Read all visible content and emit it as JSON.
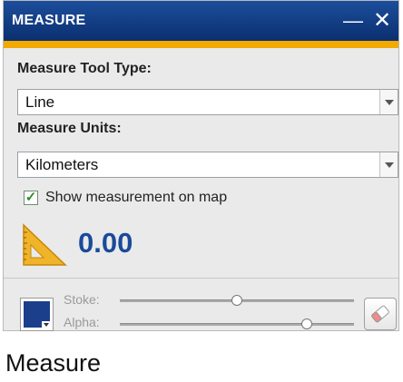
{
  "window": {
    "title": "MEASURE",
    "minimize_label": "—",
    "close_label": "✕",
    "accent_color": "#f2a900",
    "header_color": "#0f3a85"
  },
  "tool_type": {
    "label": "Measure Tool Type:",
    "selected": "Line"
  },
  "units": {
    "label": "Measure Units:",
    "selected": "Kilometers"
  },
  "show_on_map": {
    "checked": true,
    "label": "Show measurement on map"
  },
  "result": {
    "value": "0.00",
    "icon": "ruler-triangle-icon"
  },
  "style": {
    "stroke_label": "Stoke:",
    "alpha_label": "Alpha:",
    "stroke_level": 0.5,
    "alpha_level": 0.8,
    "swatch_color": "#1c3f8c",
    "clear_icon": "eraser-icon"
  },
  "caption": "Measure"
}
